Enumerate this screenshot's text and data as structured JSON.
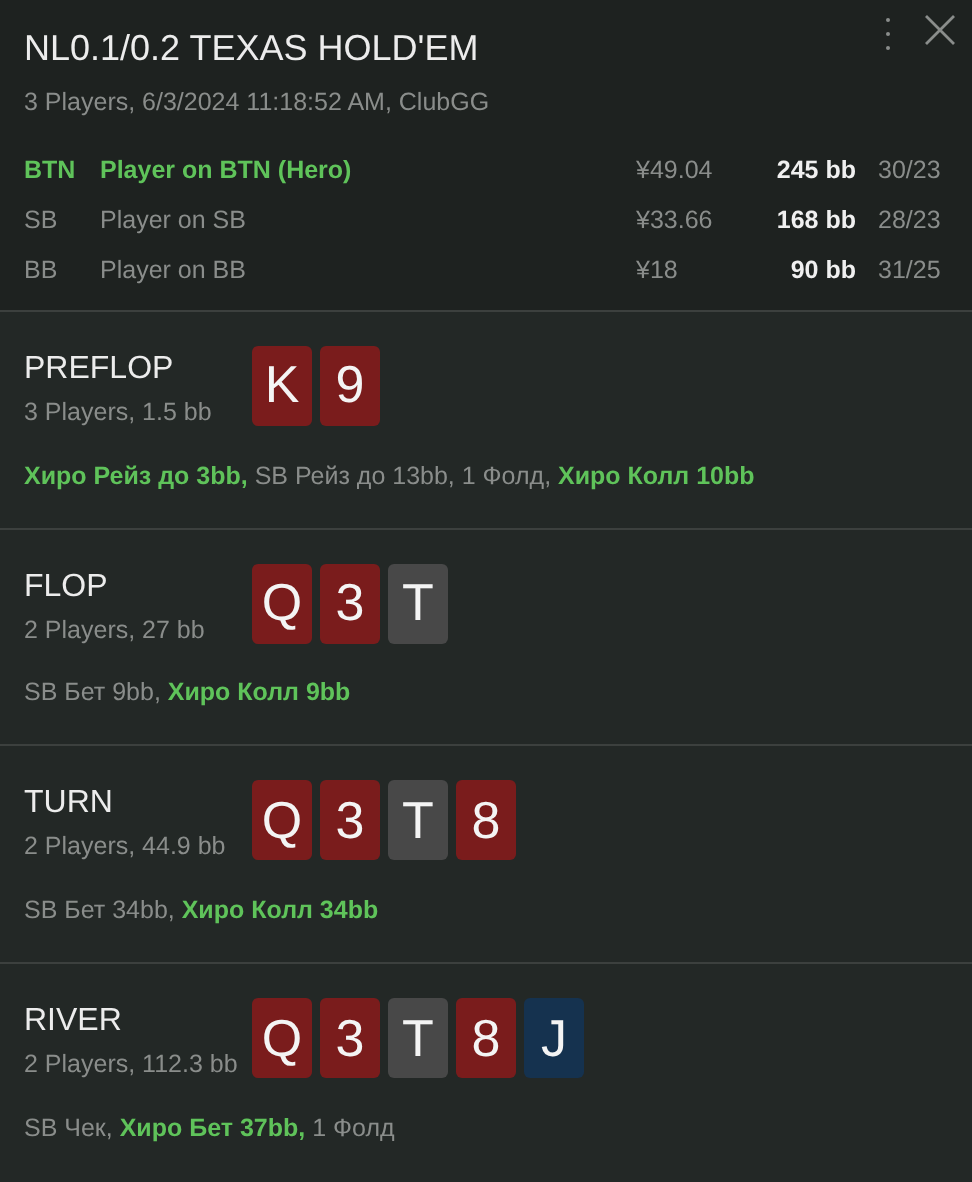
{
  "header": {
    "title": "NL0.1/0.2 TEXAS HOLD'EM",
    "subtitle": "3 Players, 6/3/2024 11:18:52 AM, ClubGG"
  },
  "players": [
    {
      "position": "BTN",
      "name": "Player on BTN (Hero)",
      "money": "¥49.04",
      "stack": "245 bb",
      "stats": "30/23",
      "hero": true
    },
    {
      "position": "SB",
      "name": "Player on SB",
      "money": "¥33.66",
      "stack": "168 bb",
      "stats": "28/23",
      "hero": false
    },
    {
      "position": "BB",
      "name": "Player on BB",
      "money": "¥18",
      "stack": "90 bb",
      "stats": "31/25",
      "hero": false
    }
  ],
  "streets": [
    {
      "name": "PREFLOP",
      "info": "3 Players, 1.5 bb",
      "cards": [
        {
          "rank": "K",
          "color": "#7a1c1c"
        },
        {
          "rank": "9",
          "color": "#7a1c1c"
        }
      ],
      "actions": [
        {
          "text": "Хиро Рейз до 3bb,",
          "hero": true
        },
        {
          "text": "SB Рейз до 13bb,",
          "hero": false
        },
        {
          "text": "1 Фолд,",
          "hero": false
        },
        {
          "text": "Хиро Колл 10bb",
          "hero": true
        }
      ]
    },
    {
      "name": "FLOP",
      "info": "2 Players, 27 bb",
      "cards": [
        {
          "rank": "Q",
          "color": "#7a1c1c"
        },
        {
          "rank": "3",
          "color": "#7a1c1c"
        },
        {
          "rank": "T",
          "color": "#484848"
        }
      ],
      "actions": [
        {
          "text": "SB Бет 9bb,",
          "hero": false
        },
        {
          "text": "Хиро Колл 9bb",
          "hero": true
        }
      ]
    },
    {
      "name": "TURN",
      "info": "2 Players, 44.9 bb",
      "cards": [
        {
          "rank": "Q",
          "color": "#7a1c1c"
        },
        {
          "rank": "3",
          "color": "#7a1c1c"
        },
        {
          "rank": "T",
          "color": "#484848"
        },
        {
          "rank": "8",
          "color": "#7a1c1c"
        }
      ],
      "actions": [
        {
          "text": "SB Бет 34bb,",
          "hero": false
        },
        {
          "text": "Хиро Колл 34bb",
          "hero": true
        }
      ]
    },
    {
      "name": "RIVER",
      "info": "2 Players, 112.3 bb",
      "cards": [
        {
          "rank": "Q",
          "color": "#7a1c1c"
        },
        {
          "rank": "3",
          "color": "#7a1c1c"
        },
        {
          "rank": "T",
          "color": "#484848"
        },
        {
          "rank": "8",
          "color": "#7a1c1c"
        },
        {
          "rank": "J",
          "color": "#15324f"
        }
      ],
      "actions": [
        {
          "text": "SB Чек,",
          "hero": false
        },
        {
          "text": "Хиро Бет 37bb,",
          "hero": true
        },
        {
          "text": "1 Фолд",
          "hero": false
        }
      ]
    }
  ]
}
